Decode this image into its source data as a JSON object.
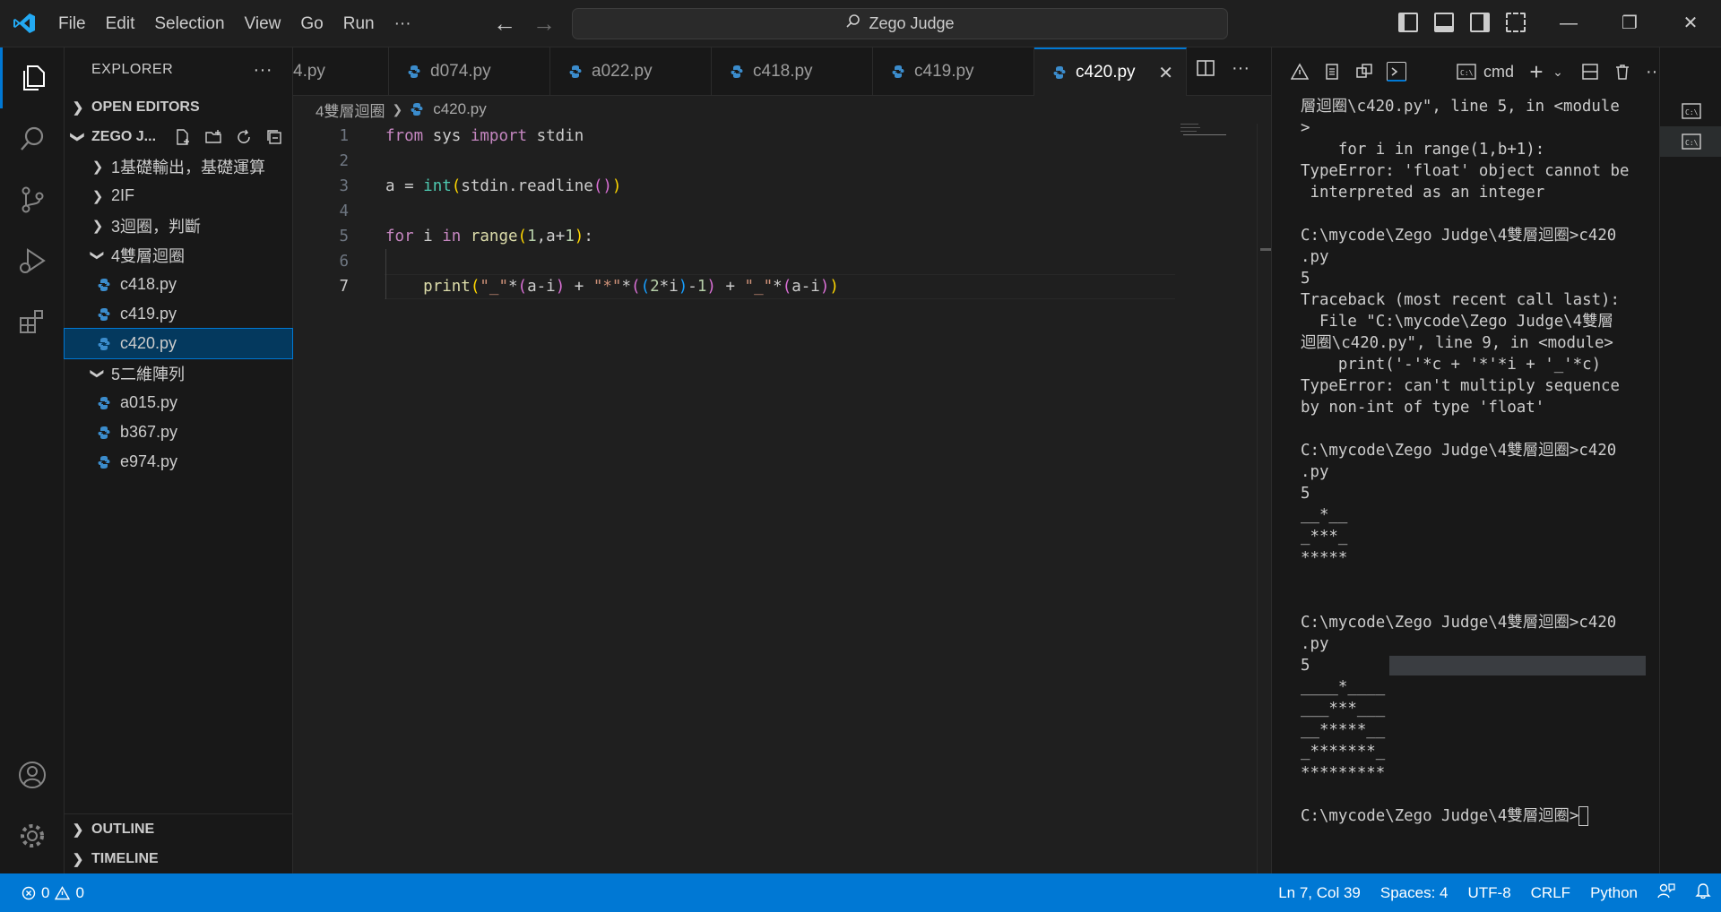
{
  "menu": [
    "File",
    "Edit",
    "Selection",
    "View",
    "Go",
    "Run",
    "···"
  ],
  "search": {
    "label": "Zego Judge"
  },
  "sidebar": {
    "title": "EXPLORER",
    "more": "···",
    "open_editors": "OPEN EDITORS",
    "project": "ZEGO J...",
    "folders": [
      {
        "label": "1基礎輸出，基礎運算",
        "expanded": false
      },
      {
        "label": "2IF",
        "expanded": false
      },
      {
        "label": "3迴圈，判斷",
        "expanded": false
      },
      {
        "label": "4雙層迴圈",
        "expanded": true,
        "files": [
          "c418.py",
          "c419.py",
          "c420.py"
        ]
      },
      {
        "label": "5二維陣列",
        "expanded": true,
        "files": [
          "a015.py",
          "b367.py",
          "e974.py"
        ]
      }
    ],
    "selected_file": "c420.py",
    "outline": "OUTLINE",
    "timeline": "TIMELINE"
  },
  "tabs": [
    {
      "label": "4.py",
      "active": false
    },
    {
      "label": "d074.py",
      "active": false
    },
    {
      "label": "a022.py",
      "active": false
    },
    {
      "label": "c418.py",
      "active": false
    },
    {
      "label": "c419.py",
      "active": false
    },
    {
      "label": "c420.py",
      "active": true
    }
  ],
  "tab_close": "✕",
  "breadcrumb": {
    "folder": "4雙層迴圈",
    "file": "c420.py"
  },
  "editor": {
    "line_numbers": [
      "1",
      "2",
      "3",
      "4",
      "5",
      "6",
      "7"
    ],
    "current_line": 7
  },
  "terminal": {
    "shell": "cmd",
    "lines": [
      "層迴圈\\c420.py\", line 5, in <module",
      ">",
      "    for i in range(1,b+1):",
      "TypeError: 'float' object cannot be",
      " interpreted as an integer",
      "",
      "C:\\mycode\\Zego Judge\\4雙層迴圈>c420",
      ".py",
      "5",
      "Traceback (most recent call last):",
      "  File \"C:\\mycode\\Zego Judge\\4雙層",
      "迴圈\\c420.py\", line 9, in <module>",
      "    print('-'*c + '*'*i + '_'*c)",
      "TypeError: can't multiply sequence",
      "by non-int of type 'float'",
      "",
      "C:\\mycode\\Zego Judge\\4雙層迴圈>c420",
      ".py",
      "5",
      "__*__",
      "_***_",
      "*****",
      "",
      "",
      "C:\\mycode\\Zego Judge\\4雙層迴圈>c420",
      ".py",
      "5",
      "____*____",
      "___***___",
      "__*****__",
      "_*******_",
      "*********",
      "",
      "C:\\mycode\\Zego Judge\\4雙層迴圈>"
    ]
  },
  "status": {
    "errors": "0",
    "warnings": "0",
    "position": "Ln 7, Col 39",
    "spaces": "Spaces: 4",
    "encoding": "UTF-8",
    "eol": "CRLF",
    "language": "Python"
  },
  "colors": {
    "accent": "#0078d4",
    "keyword": "#c586c0",
    "builtin": "#4ec9b0",
    "string": "#ce9178",
    "number": "#b5cea8",
    "function": "#dcdcaa"
  }
}
